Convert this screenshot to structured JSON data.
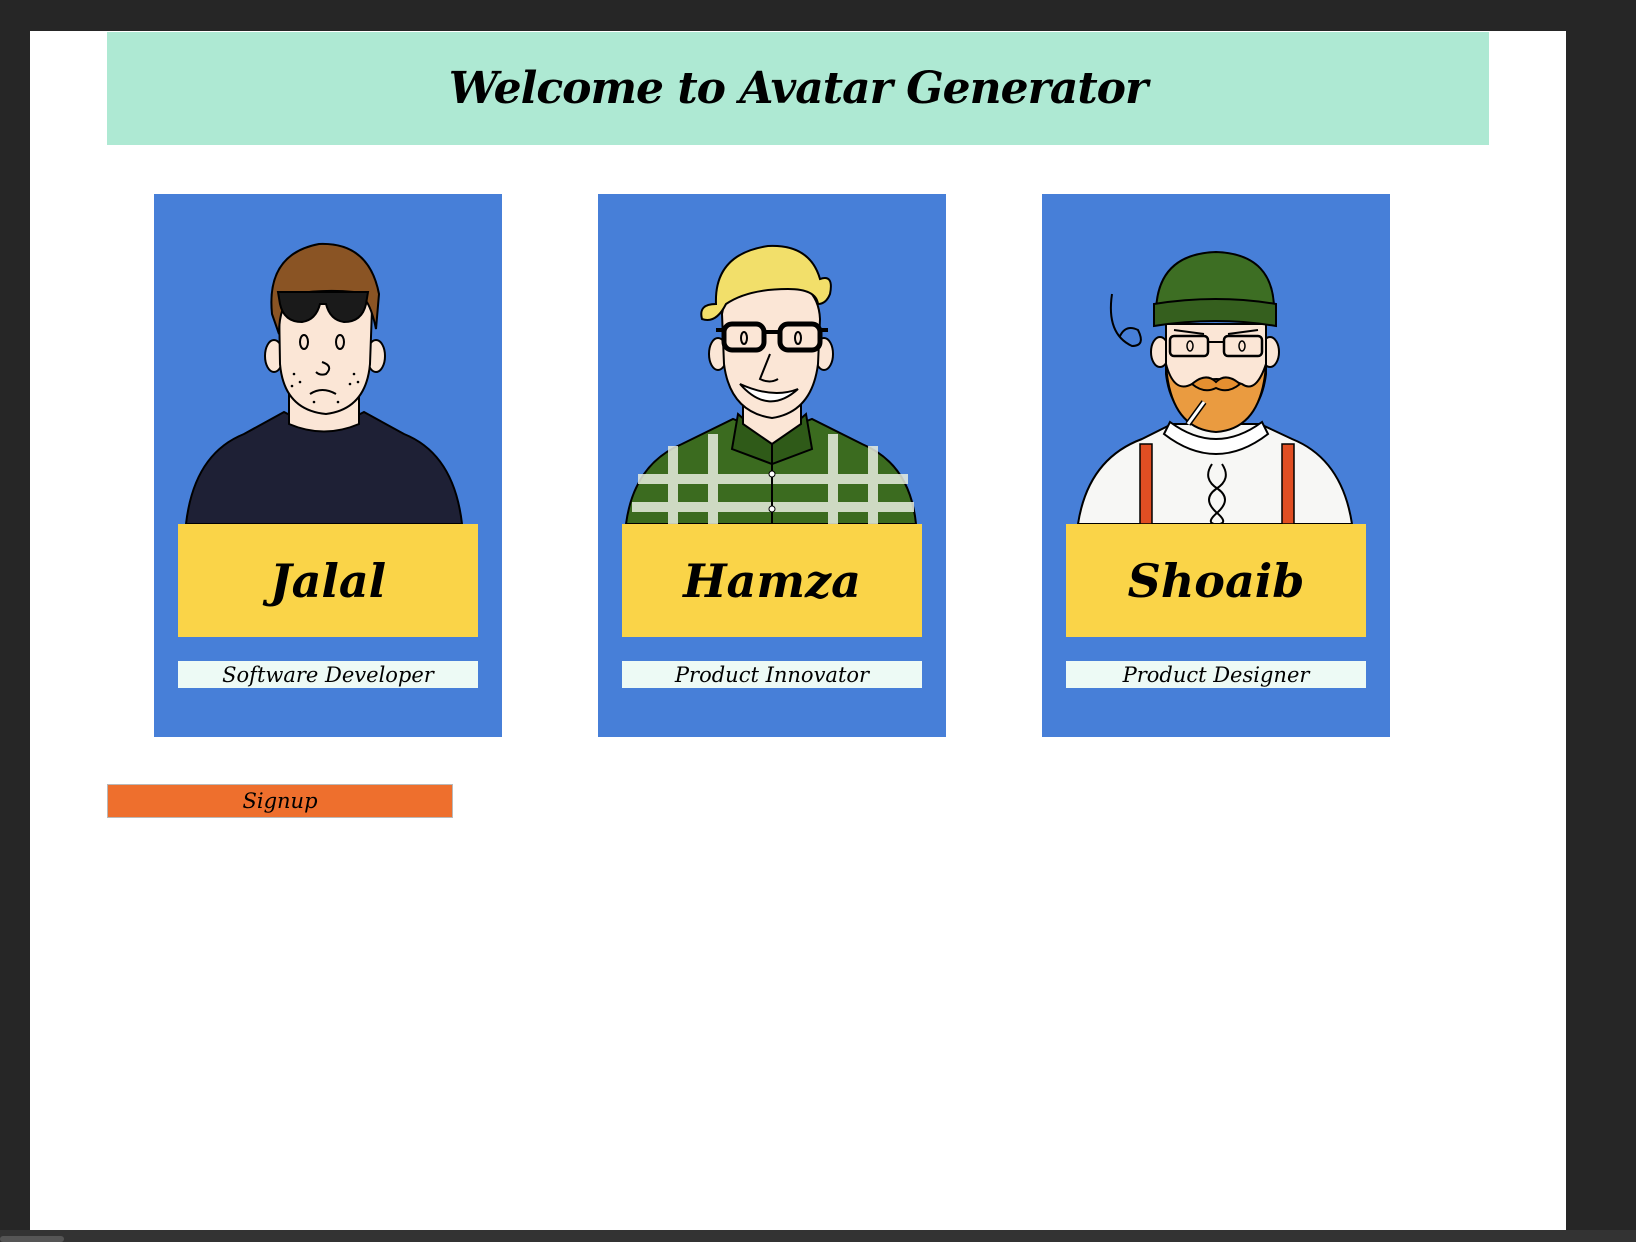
{
  "header": {
    "title": "Welcome to Avatar Generator"
  },
  "cards": [
    {
      "name": "Jalal",
      "role": "Software Developer",
      "avatar_icon": "avatar-sunglasses-man-icon"
    },
    {
      "name": "Hamza",
      "role": "Product Innovator",
      "avatar_icon": "avatar-blond-glasses-man-icon"
    },
    {
      "name": "Shoaib",
      "role": "Product Designer",
      "avatar_icon": "avatar-bearded-beanie-man-icon"
    }
  ],
  "signup": {
    "label": "Signup"
  },
  "colors": {
    "header_bg": "#aee9d3",
    "card_bg": "#477fd8",
    "name_bg": "#fad448",
    "role_bg": "#edfaf5",
    "signup_bg": "#ee6f2d"
  }
}
